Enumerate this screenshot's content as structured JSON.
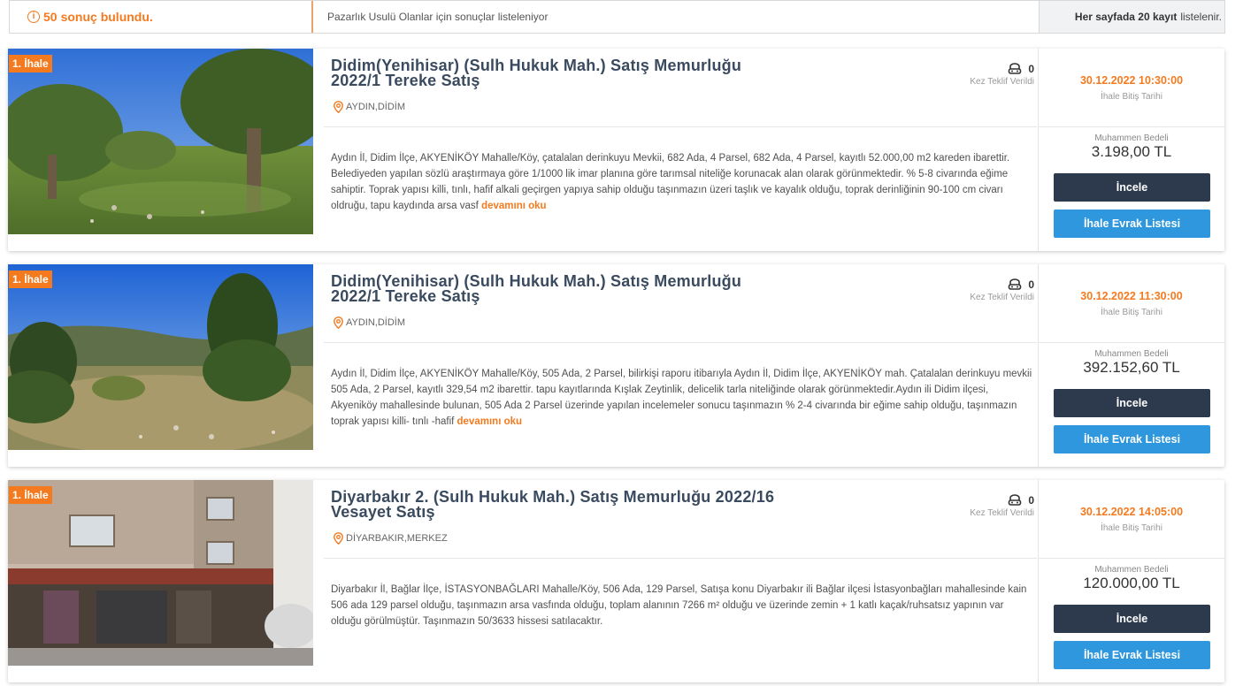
{
  "topbar": {
    "info_icon": "i",
    "count": "50",
    "count_text": "sonuç bulundu.",
    "filter_text": "Pazarlık Usulü Olanlar için sonuçlar listeleniyor",
    "perpage_bold": "Her sayfada 20 kayıt",
    "perpage_rest": "listelenir."
  },
  "listings": [
    {
      "badge": "1. İhale",
      "title_line1": "Didim(Yenihisar) (Sulh Hukuk Mah.) Satış Memurluğu",
      "title_line2": "2022/1 Tereke Satış",
      "location": "AYDIN,DİDİM",
      "bid_count": "0",
      "bid_label": "Kez Teklif Verildi",
      "description": "Aydın İl, Didim İlçe, AKYENİKÖY Mahalle/Köy, çatalalan derinkuyu Mevkii, 682 Ada, 4 Parsel, 682 Ada, 4 Parsel, kayıtlı 52.000,00 m2 kareden ibarettir. Belediyeden yapılan sözlü araştırmaya göre 1/1000 lik imar planına göre tarımsal niteliğe korunacak alan olarak görünmektedir. % 5-8 civarında eğime sahiptir. Toprak yapısı killi, tınlı, hafif alkali geçirgen yapıya sahip olduğu taşınmazın üzeri taşlık ve kayalık olduğu, toprak derinliğinin 90-100 cm civarı oldruğu, tapu kaydında arsa vasf",
      "more": "devamını oku",
      "end_date": "30.12.2022 10:30:00",
      "end_date_label": "İhale Bitiş Tarihi",
      "estimated_label": "Muhammen Bedeli",
      "price": "3.198,00 TL",
      "btn_inspect": "İncele",
      "btn_docs": "İhale Evrak Listesi"
    },
    {
      "badge": "1. İhale",
      "title_line1": "Didim(Yenihisar) (Sulh Hukuk Mah.) Satış Memurluğu",
      "title_line2": "2022/1 Tereke Satış",
      "location": "AYDIN,DİDİM",
      "bid_count": "0",
      "bid_label": "Kez Teklif Verildi",
      "description": "Aydın İl, Didim İlçe, AKYENİKÖY Mahalle/Köy, 505 Ada, 2 Parsel, bilirkişi raporu itibarıyla Aydın İl, Didim İlçe, AKYENİKÖY mah. Çatalalan derinkuyu mevkii 505 Ada, 2 Parsel, kayıtlı 329,54 m2 ibarettir. tapu kayıtlarında Kışlak Zeytinlik, delicelik tarla niteliğinde olarak görünmektedir.Aydın ili Didim ilçesi, Akyeniköy mahallesinde bulunan, 505 Ada 2 Parsel üzerinde yapılan incelemeler sonucu taşınmazın % 2-4 civarında bir eğime sahip olduğu, taşınmazın toprak yapısı killi- tınlı -hafif",
      "more": "devamını oku",
      "end_date": "30.12.2022 11:30:00",
      "end_date_label": "İhale Bitiş Tarihi",
      "estimated_label": "Muhammen Bedeli",
      "price": "392.152,60 TL",
      "btn_inspect": "İncele",
      "btn_docs": "İhale Evrak Listesi"
    },
    {
      "badge": "1. İhale",
      "title_line1": "Diyarbakır 2. (Sulh Hukuk Mah.) Satış Memurluğu 2022/16",
      "title_line2": "Vesayet Satış",
      "location": "DİYARBAKIR,MERKEZ",
      "bid_count": "0",
      "bid_label": "Kez Teklif Verildi",
      "description": "Diyarbakır İl, Bağlar İlçe, İSTASYONBAĞLARI Mahalle/Köy, 506 Ada, 129 Parsel, Satışa konu Diyarbakır ili Bağlar ilçesi İstasyonbağları mahallesinde kain 506 ada 129 parsel olduğu, taşınmazın arsa vasfında olduğu, toplam alanının 7266 m² olduğu ve üzerinde zemin + 1 katlı kaçak/ruhsatsız yapının var olduğu görülmüştür. Taşınmazın 50/3633 hissesi satılacaktır.",
      "more": "",
      "end_date": "30.12.2022 14:05:00",
      "end_date_label": "İhale Bitiş Tarihi",
      "estimated_label": "Muhammen Bedeli",
      "price": "120.000,00 TL",
      "btn_inspect": "İncele",
      "btn_docs": "İhale Evrak Listesi"
    }
  ],
  "colors": {
    "accent_orange": "#f47a1f",
    "button_dark": "#2d3a4e",
    "button_blue": "#2e97de",
    "title": "#3a4a5f"
  },
  "icons": [
    "info-icon",
    "location-pin-icon",
    "gavel-icon"
  ]
}
